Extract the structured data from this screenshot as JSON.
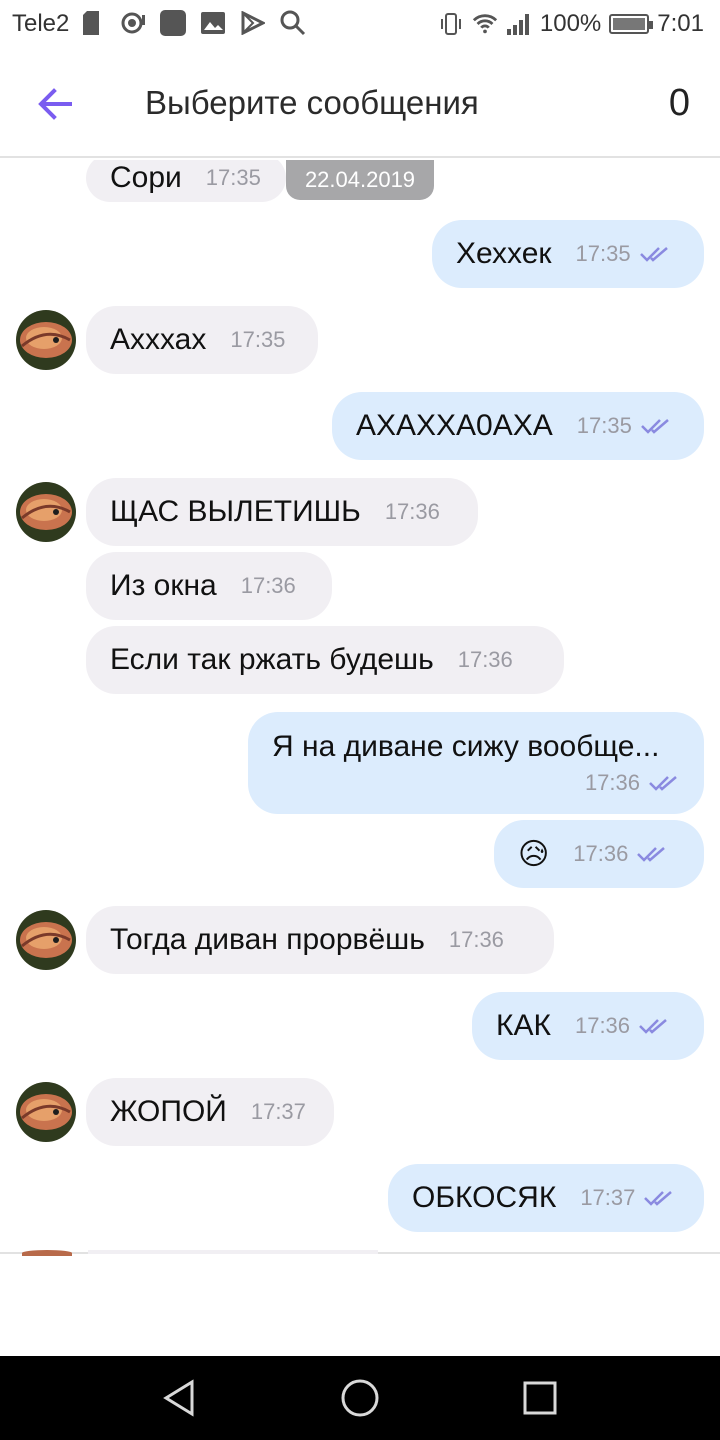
{
  "status_bar": {
    "carrier": "Tele2",
    "battery": "100%",
    "time": "7:01",
    "battery_level": 1.0
  },
  "header": {
    "title": "Выберите сообщения",
    "selected_count": "0"
  },
  "date_pill": "22.04.2019",
  "colors": {
    "accent": "#7a5cf0",
    "incoming_bubble": "#f1eff3",
    "outgoing_bubble": "#dcecfd",
    "time_text": "#9a9aa2",
    "tick": "#8a8ae0"
  },
  "messages": [
    {
      "dir": "in",
      "text": "Сори",
      "time": "17:35"
    },
    {
      "dir": "out",
      "text": "Хеххек",
      "time": "17:35"
    },
    {
      "dir": "in",
      "text": "Ахххах",
      "time": "17:35",
      "avatar": true
    },
    {
      "dir": "out",
      "text": "АХАХХА0АХА",
      "time": "17:35"
    },
    {
      "dir": "in",
      "text": "ЩАС ВЫЛЕТИШЬ",
      "time": "17:36",
      "avatar": true
    },
    {
      "dir": "in",
      "text": "Из окна",
      "time": "17:36"
    },
    {
      "dir": "in",
      "text": "Если так ржать будешь",
      "time": "17:36"
    },
    {
      "dir": "out",
      "text": "Я на диване сижу вообще...",
      "time": "17:36"
    },
    {
      "dir": "out",
      "text": "😥",
      "time": "17:36"
    },
    {
      "dir": "in",
      "text": "Тогда диван прорвёшь",
      "time": "17:36",
      "avatar": true
    },
    {
      "dir": "out",
      "text": "КАК",
      "time": "17:36"
    },
    {
      "dir": "in",
      "text": "ЖОПОЙ",
      "time": "17:37",
      "avatar": true
    },
    {
      "dir": "out",
      "text": "ОБКОСЯК",
      "time": "17:37"
    }
  ],
  "icons": {
    "back": "arrow-left-icon",
    "nav_back": "triangle-back-icon",
    "nav_home": "circle-home-icon",
    "nav_recents": "square-recents-icon"
  }
}
